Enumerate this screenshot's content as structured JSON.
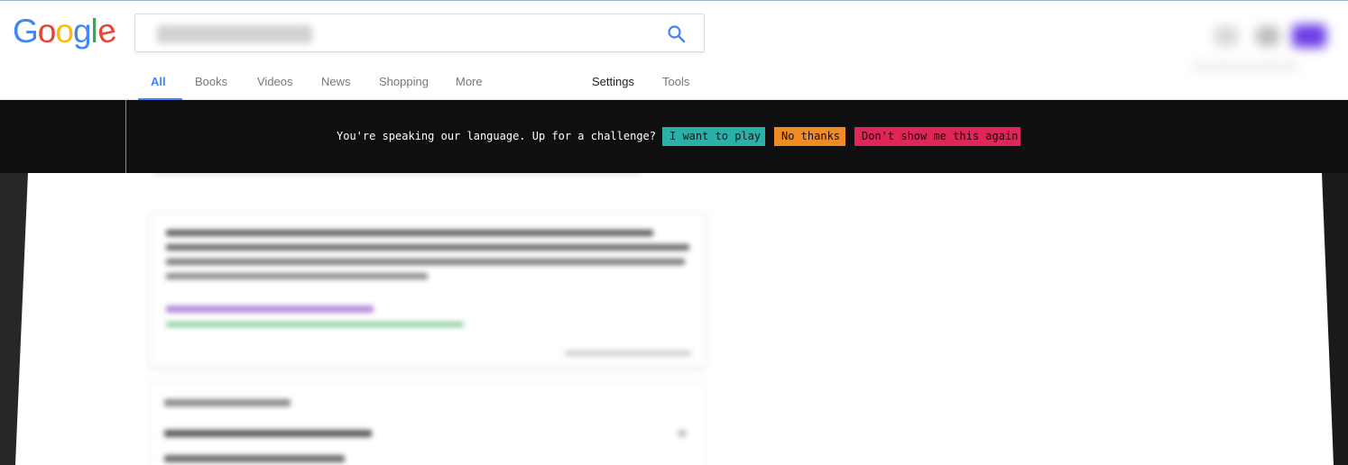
{
  "logo": {
    "letters": [
      {
        "char": "G",
        "color": "#4285F4"
      },
      {
        "char": "o",
        "color": "#EA4335"
      },
      {
        "char": "o",
        "color": "#FBBC05"
      },
      {
        "char": "g",
        "color": "#4285F4"
      },
      {
        "char": "l",
        "color": "#34A853"
      },
      {
        "char": "e",
        "color": "#EA4335"
      }
    ]
  },
  "search": {
    "value": "",
    "icon": "search-icon",
    "icon_color": "#4285F4"
  },
  "tabs": [
    {
      "label": "All",
      "active": true
    },
    {
      "label": "Books"
    },
    {
      "label": "Videos"
    },
    {
      "label": "News"
    },
    {
      "label": "Shopping"
    },
    {
      "label": "More"
    }
  ],
  "tools": {
    "settings": "Settings",
    "tools": "Tools"
  },
  "banner": {
    "prompt": "You're speaking our language. Up for a challenge?",
    "play": "I want to play",
    "no_thanks": "No thanks",
    "dont_show": "Don't show me this again",
    "colors": {
      "play": "#2AB0A8",
      "no_thanks": "#F08A24",
      "dont_show": "#E02557",
      "background": "#0F0F0F"
    }
  },
  "accent": "#4285F4"
}
